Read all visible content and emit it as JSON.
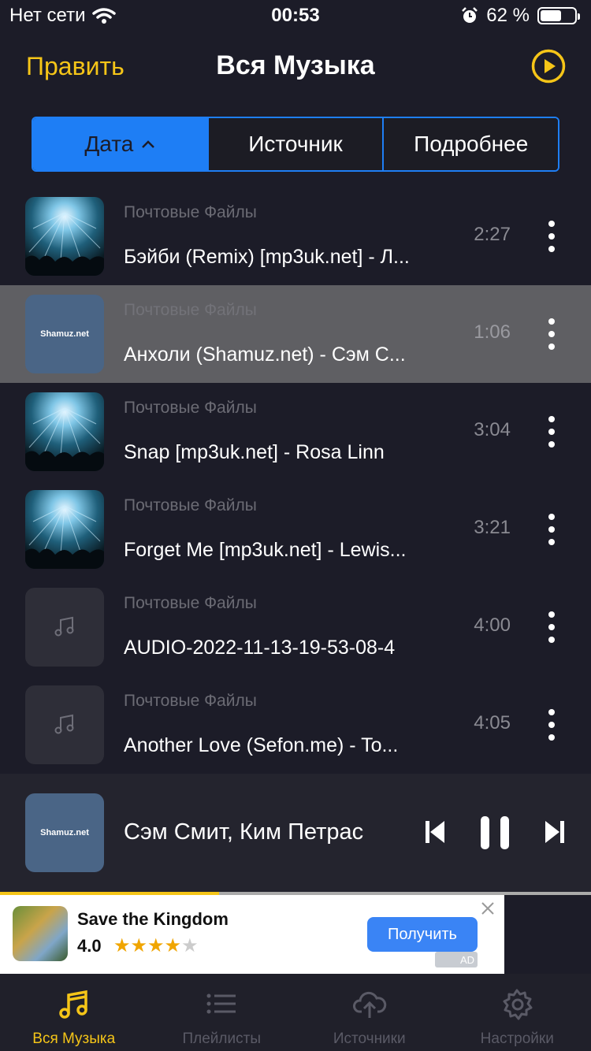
{
  "status_bar": {
    "carrier": "Нет сети",
    "time": "00:53",
    "battery_percent": "62 %",
    "battery_level": 0.62
  },
  "header": {
    "edit_label": "Править",
    "title": "Вся Музыка"
  },
  "sort_tabs": [
    {
      "label": "Дата",
      "active": true
    },
    {
      "label": "Источник",
      "active": false
    },
    {
      "label": "Подробнее",
      "active": false
    }
  ],
  "tracks": [
    {
      "source": "Почтовые Файлы",
      "title": "Бэйби (Remix) [mp3uk.net] - Л...",
      "duration": "2:27",
      "art": "concert"
    },
    {
      "source": "Почтовые Файлы",
      "title": "Анхоли (Shamuz.net) - Сэм С...",
      "duration": "1:06",
      "art": "shamuz",
      "art_text": "Shamuz.net",
      "selected": true
    },
    {
      "source": "Почтовые Файлы",
      "title": "Snap [mp3uk.net] - Rosa Linn",
      "duration": "3:04",
      "art": "concert"
    },
    {
      "source": "Почтовые Файлы",
      "title": "Forget Me [mp3uk.net] - Lewis...",
      "duration": "3:21",
      "art": "concert"
    },
    {
      "source": "Почтовые Файлы",
      "title": "AUDIO-2022-11-13-19-53-08-4",
      "duration": "4:00",
      "art": "music-note"
    },
    {
      "source": "Почтовые Файлы",
      "title": "Another Love (Sefon.me) - To...",
      "duration": "4:05",
      "art": "music-note"
    }
  ],
  "now_playing": {
    "art_text": "Shamuz.net",
    "title": "Сэм Смит, Ким Петрас",
    "progress": 0.37
  },
  "ad": {
    "title": "Save the Kingdom",
    "rating": "4.0",
    "stars_filled": 4,
    "stars_total": 5,
    "button_label": "Получить",
    "badge": "AD"
  },
  "tabbar": [
    {
      "label": "Вся Музыка",
      "icon": "music-note-icon",
      "active": true
    },
    {
      "label": "Плейлисты",
      "icon": "playlist-icon",
      "active": false
    },
    {
      "label": "Источники",
      "icon": "cloud-upload-icon",
      "active": false
    },
    {
      "label": "Настройки",
      "icon": "gear-icon",
      "active": false
    }
  ],
  "colors": {
    "accent": "#f5c518",
    "segment_blue": "#1e7ef5",
    "background": "#1c1c28"
  }
}
